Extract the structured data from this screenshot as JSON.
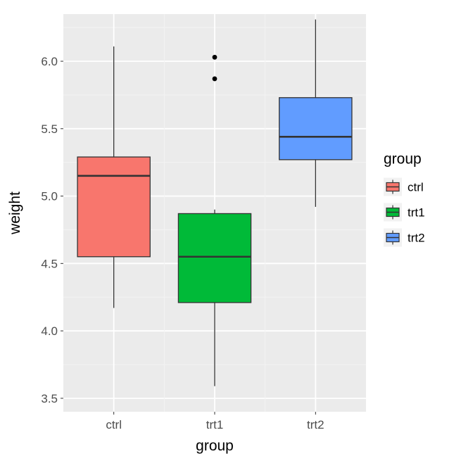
{
  "chart_data": {
    "type": "boxplot",
    "xlabel": "group",
    "ylabel": "weight",
    "ylim": [
      3.4,
      6.35
    ],
    "y_ticks": [
      3.5,
      4.0,
      4.5,
      5.0,
      5.5,
      6.0
    ],
    "categories": [
      "ctrl",
      "trt1",
      "trt2"
    ],
    "legend_title": "group",
    "series": [
      {
        "name": "ctrl",
        "color": "#F8766D",
        "min": 4.17,
        "q1": 4.55,
        "median": 5.15,
        "q3": 5.29,
        "max": 6.11,
        "outliers": []
      },
      {
        "name": "trt1",
        "color": "#00BA38",
        "min": 3.59,
        "q1": 4.21,
        "median": 4.55,
        "q3": 4.87,
        "max": 4.9,
        "outliers": [
          5.87,
          6.03
        ]
      },
      {
        "name": "trt2",
        "color": "#619CFF",
        "min": 4.92,
        "q1": 5.27,
        "median": 5.44,
        "q3": 5.73,
        "max": 6.31,
        "outliers": []
      }
    ]
  }
}
